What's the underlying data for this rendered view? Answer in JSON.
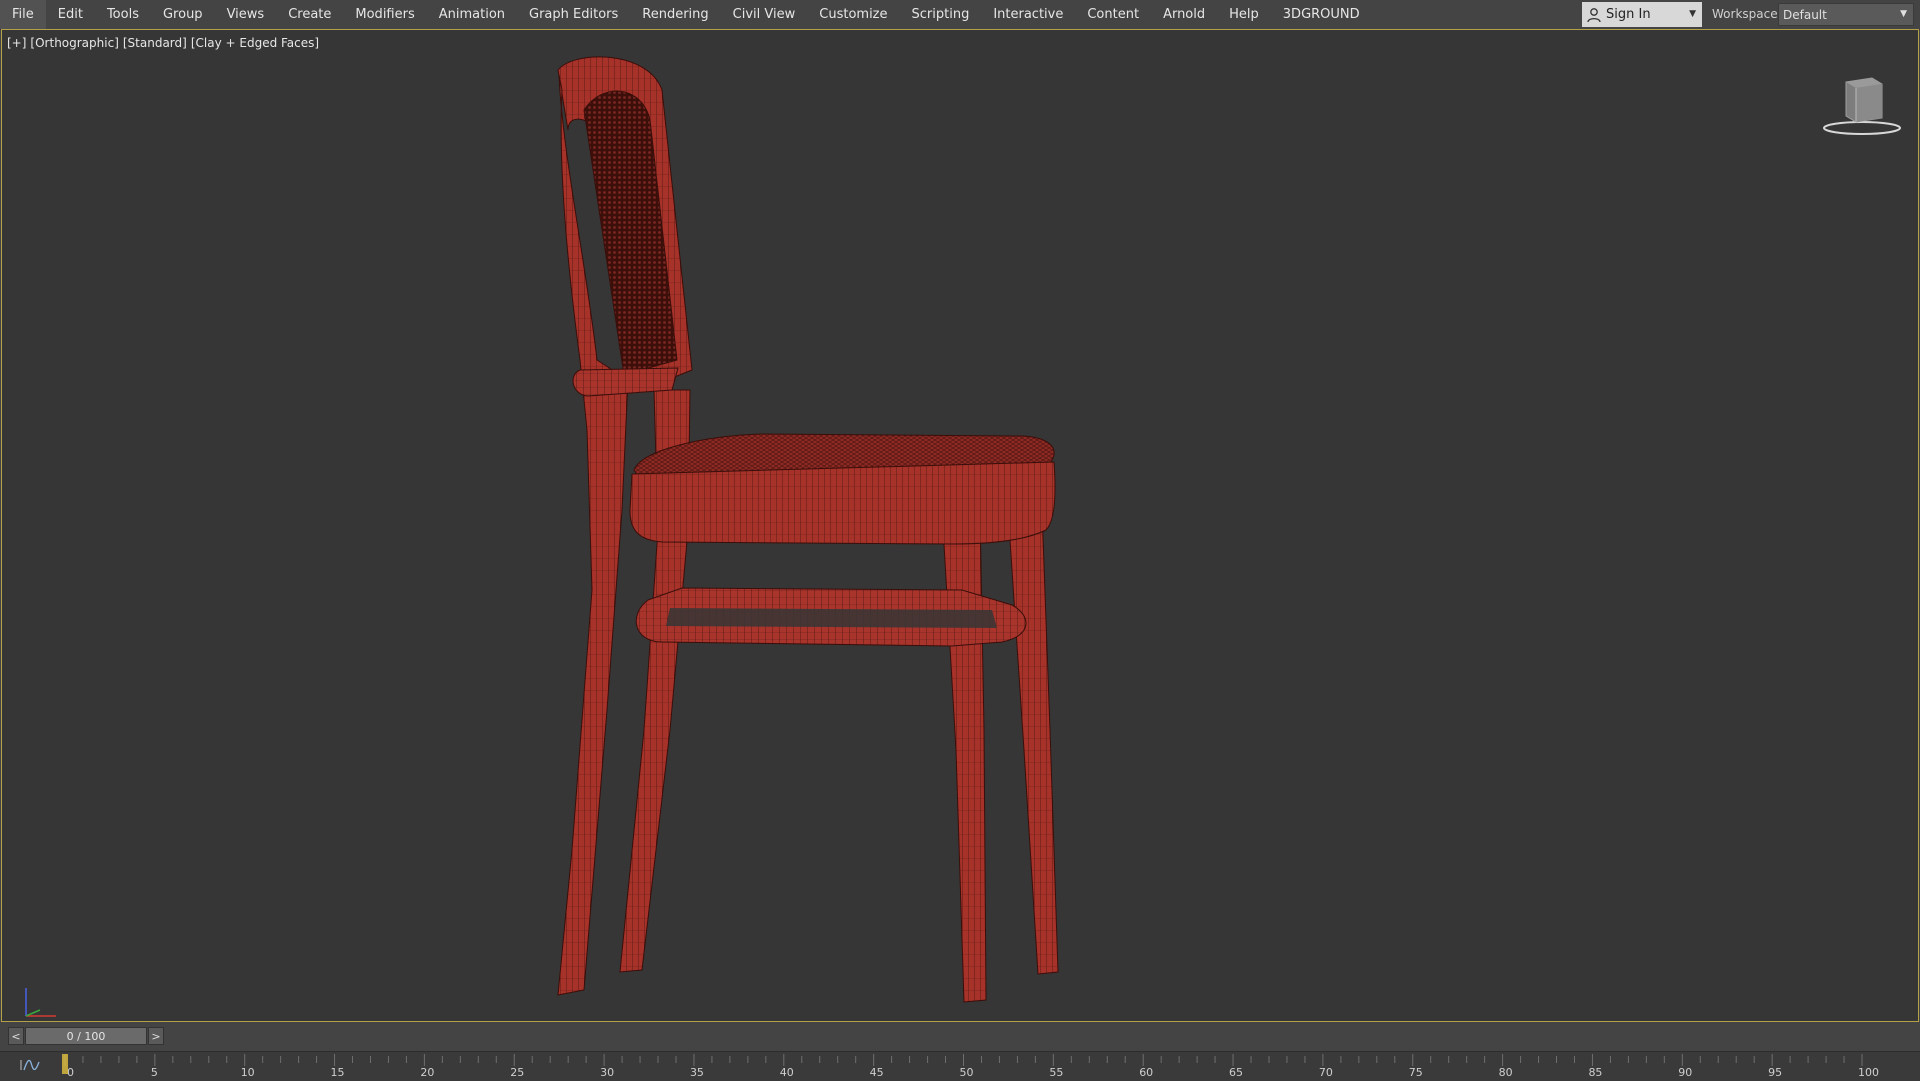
{
  "menubar": {
    "items": [
      "File",
      "Edit",
      "Tools",
      "Group",
      "Views",
      "Create",
      "Modifiers",
      "Animation",
      "Graph Editors",
      "Rendering",
      "Civil View",
      "Customize",
      "Scripting",
      "Interactive",
      "Content",
      "Arnold",
      "Help",
      "3DGROUND"
    ],
    "active_item": "File"
  },
  "account": {
    "signin_label": "Sign In",
    "user_icon": "user-icon"
  },
  "workspaces": {
    "label": "Workspaces:",
    "selected": "Default"
  },
  "viewport": {
    "label_parts": [
      "[+]",
      "[Orthographic]",
      "[Standard]",
      "[Clay + Edged Faces]"
    ],
    "border_color": "#b5a04a",
    "background_color": "#363636",
    "model_color": "#a8342c",
    "view_cube_icon": "view-cube-icon",
    "axis_icon": "axis-tripod-icon"
  },
  "time_slider": {
    "prev_label": "<",
    "next_label": ">",
    "frame_display": "0 / 100",
    "current_frame": 0,
    "total_frames": 100
  },
  "trackbar": {
    "tick_labels": [
      "0",
      "5",
      "10",
      "15",
      "20",
      "25",
      "30",
      "35",
      "40",
      "45",
      "50",
      "55",
      "60",
      "65",
      "70",
      "75",
      "80",
      "85",
      "90",
      "95",
      "100"
    ],
    "curve_icon": "mini-curve-editor-icon"
  }
}
